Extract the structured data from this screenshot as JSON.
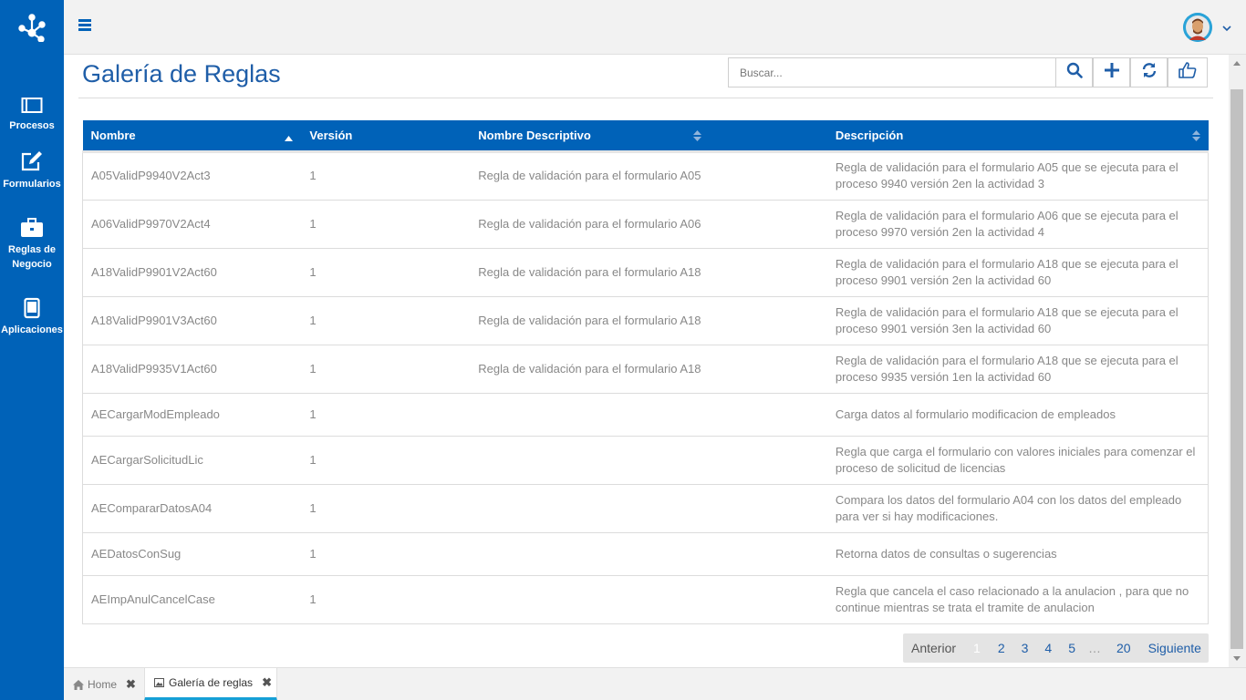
{
  "sidebar": {
    "items": [
      {
        "label": "Procesos"
      },
      {
        "label": "Formularios"
      },
      {
        "label": "Reglas de Negocio"
      },
      {
        "label": "Aplicaciones"
      }
    ]
  },
  "header": {
    "title": "Galería de Reglas",
    "search_placeholder": "Buscar..."
  },
  "table": {
    "columns": [
      "Nombre",
      "Versión",
      "Nombre Descriptivo",
      "Descripción"
    ],
    "rows": [
      {
        "nombre": "A05ValidP9940V2Act3",
        "version": "1",
        "nombre_descriptivo": "Regla de validación para el formulario A05",
        "descripcion": "Regla de validación para el formulario A05 que se ejecuta para el proceso 9940 versión 2en la actividad 3"
      },
      {
        "nombre": "A06ValidP9970V2Act4",
        "version": "1",
        "nombre_descriptivo": "Regla de validación para el formulario A06",
        "descripcion": "Regla de validación para el formulario A06 que se ejecuta para el proceso 9970 versión 2en la actividad 4"
      },
      {
        "nombre": "A18ValidP9901V2Act60",
        "version": "1",
        "nombre_descriptivo": "Regla de validación para el formulario A18",
        "descripcion": "Regla de validación para el formulario A18 que se ejecuta para el proceso 9901 versión 2en la actividad 60"
      },
      {
        "nombre": "A18ValidP9901V3Act60",
        "version": "1",
        "nombre_descriptivo": "Regla de validación para el formulario A18",
        "descripcion": "Regla de validación para el formulario A18 que se ejecuta para el proceso 9901 versión 3en la actividad 60"
      },
      {
        "nombre": "A18ValidP9935V1Act60",
        "version": "1",
        "nombre_descriptivo": "Regla de validación para el formulario A18",
        "descripcion": "Regla de validación para el formulario A18 que se ejecuta para el proceso 9935 versión 1en la actividad 60"
      },
      {
        "nombre": "AECargarModEmpleado",
        "version": "1",
        "nombre_descriptivo": "",
        "descripcion": "Carga datos al formulario modificacion de empleados"
      },
      {
        "nombre": "AECargarSolicitudLic",
        "version": "1",
        "nombre_descriptivo": "",
        "descripcion": "Regla que carga el formulario con valores iniciales para comenzar el proceso de solicitud de licencias"
      },
      {
        "nombre": "AECompararDatosA04",
        "version": "1",
        "nombre_descriptivo": "",
        "descripcion": "Compara los datos del formulario A04 con los datos del empleado para ver si hay modificaciones."
      },
      {
        "nombre": "AEDatosConSug",
        "version": "1",
        "nombre_descriptivo": "",
        "descripcion": "Retorna datos de consultas o sugerencias"
      },
      {
        "nombre": "AEImpAnulCancelCase",
        "version": "1",
        "nombre_descriptivo": "",
        "descripcion": "Regla que cancela el caso relacionado a la anulacion , para que no continue mientras se trata el tramite de anulacion"
      }
    ]
  },
  "pagination": {
    "prev": "Anterior",
    "pages": [
      "1",
      "2",
      "3",
      "4",
      "5"
    ],
    "ellipsis": "…",
    "last": "20",
    "next": "Siguiente",
    "current": "1"
  },
  "tabs": [
    {
      "label": "Home"
    },
    {
      "label": "Galería de reglas"
    }
  ],
  "colors": {
    "brand": "#0062b8",
    "title": "#1f5ea8",
    "tab_active_indicator": "#16a0d6"
  }
}
